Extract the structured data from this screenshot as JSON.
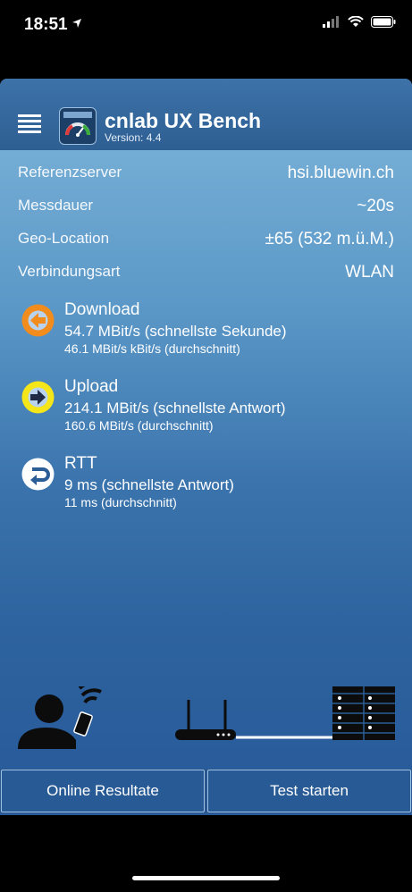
{
  "status": {
    "time": "18:51"
  },
  "header": {
    "title": "cnlab UX Bench",
    "version": "Version: 4.4"
  },
  "info": [
    {
      "label": "Referenzserver",
      "value": "hsi.bluewin.ch"
    },
    {
      "label": "Messdauer",
      "value": "~20s"
    },
    {
      "label": "Geo-Location",
      "value": "±65 (532 m.ü.M.)"
    },
    {
      "label": "Verbindungsart",
      "value": "WLAN"
    }
  ],
  "metrics": {
    "download": {
      "title": "Download",
      "primary": "54.7 MBit/s (schnellste Sekunde)",
      "secondary": "46.1 MBit/s kBit/s (durchschnitt)"
    },
    "upload": {
      "title": "Upload",
      "primary": "214.1 MBit/s (schnellste Antwort)",
      "secondary": "160.6 MBit/s (durchschnitt)"
    },
    "rtt": {
      "title": "RTT",
      "primary": "9 ms (schnellste Antwort)",
      "secondary": "11 ms (durchschnitt)"
    }
  },
  "buttons": {
    "online_results": "Online Resultate",
    "start_test": "Test starten"
  },
  "colors": {
    "download": "#f28c1c",
    "upload": "#f5e61a",
    "rtt": "#ffffff"
  }
}
